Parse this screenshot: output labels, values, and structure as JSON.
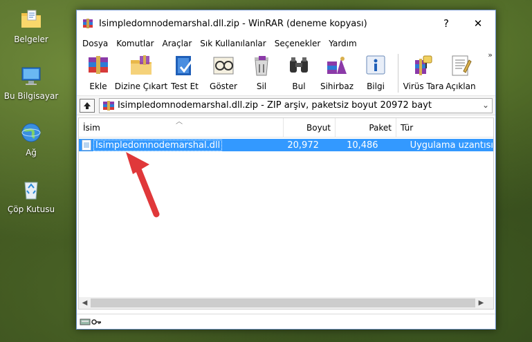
{
  "desktop": {
    "icons": [
      {
        "label": "Belgeler"
      },
      {
        "label": "Bu Bilgisayar"
      },
      {
        "label": "Ağ"
      },
      {
        "label": "Çöp Kutusu"
      }
    ]
  },
  "window": {
    "title": "Isimpledomnodemarshal.dll.zip - WinRAR (deneme kopyası)",
    "help_glyph": "?",
    "close_glyph": "✕"
  },
  "menu": [
    "Dosya",
    "Komutlar",
    "Araçlar",
    "Sık Kullanılanlar",
    "Seçenekler",
    "Yardım"
  ],
  "toolbar": [
    {
      "label": "Ekle",
      "icon": "add-archive-icon"
    },
    {
      "label": "Dizine Çıkart",
      "icon": "extract-to-icon"
    },
    {
      "label": "Test Et",
      "icon": "test-icon"
    },
    {
      "label": "Göster",
      "icon": "view-icon"
    },
    {
      "label": "Sil",
      "icon": "delete-icon"
    },
    {
      "label": "Bul",
      "icon": "find-icon"
    },
    {
      "label": "Sihirbaz",
      "icon": "wizard-icon"
    },
    {
      "label": "Bilgi",
      "icon": "info-icon"
    },
    {
      "label": "Virüs Tara",
      "icon": "virus-scan-icon"
    },
    {
      "label": "Açıklan",
      "icon": "comment-icon"
    }
  ],
  "toolbar_overflow": "»",
  "path": {
    "text": "Isimpledomnodemarshal.dll.zip - ZIP arşiv, paketsiz boyut 20972 bayt"
  },
  "columns": {
    "name": "İsim",
    "size": "Boyut",
    "packed": "Paket",
    "type": "Tür"
  },
  "files": [
    {
      "name": "Isimpledomnodemarshal.dll",
      "size": "20,972",
      "packed": "10,486",
      "type": "Uygulama uzantısı"
    }
  ],
  "colors": {
    "selection": "#3399ff",
    "annotation_arrow": "#e0383a"
  }
}
